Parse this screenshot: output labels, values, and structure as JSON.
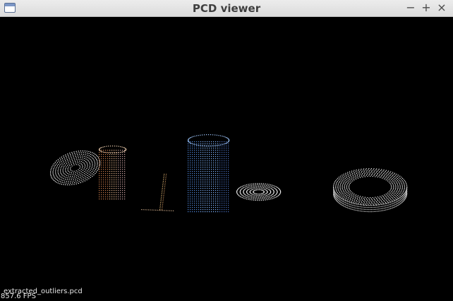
{
  "window": {
    "title": "PCD viewer",
    "controls": {
      "minimize": "−",
      "maximize": "+",
      "close": "×"
    }
  },
  "viewer": {
    "filename": "extracted_outliers.pcd",
    "fps": "857.6 FPS",
    "background": "#000000",
    "objects": [
      {
        "name": "plate",
        "color": "#e8e8e8"
      },
      {
        "name": "mug",
        "color": "#e0a070"
      },
      {
        "name": "stand",
        "color": "#d9b070"
      },
      {
        "name": "can",
        "color": "#6aa6ff"
      },
      {
        "name": "bowl",
        "color": "#f0f0f0"
      },
      {
        "name": "tape-roll",
        "color": "#e6e6e6"
      }
    ]
  }
}
